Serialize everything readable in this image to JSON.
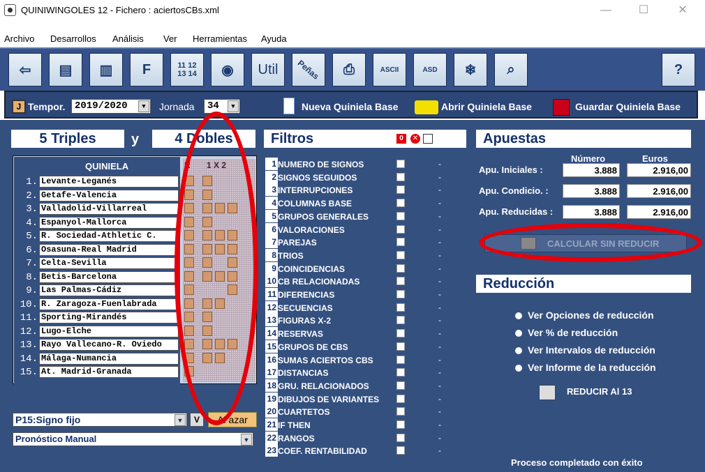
{
  "window": {
    "title": "QUINIWINGOLES 12 - Fichero : aciertosCBs.xml",
    "minimize": "—",
    "maximize": "☐",
    "close": "✕"
  },
  "menu": [
    "Archivo",
    "Desarrollos",
    "Análisis",
    "Ver",
    "Herramientas",
    "Ayuda"
  ],
  "toolbar": {
    "util": "Util",
    "penas": "Peñas",
    "btn_1112": "11 12",
    "btn_1314": "13 14",
    "ascii": "ASCII",
    "asd": "ASD"
  },
  "tbar2": {
    "tempor_label": "Tempor.",
    "tempor_value": "2019/2020",
    "jornada_label": "Jornada",
    "jornada_value": "34",
    "nueva": "Nueva Quiniela Base",
    "abrir": "Abrir Quiniela Base",
    "guardar": "Guardar Quiniela Base"
  },
  "summary": {
    "triples": "5 Triples",
    "y": "y",
    "dobles": "4 Dobles"
  },
  "quiniela": {
    "title": "QUINIELA",
    "col_r": "R",
    "col_1x2": "1 X 2",
    "rows": [
      {
        "n": "1.",
        "match": "Levante-Leganés"
      },
      {
        "n": "2.",
        "match": "Getafe-Valencia"
      },
      {
        "n": "3.",
        "match": "Valladolid-Villarreal"
      },
      {
        "n": "4.",
        "match": "Espanyol-Mallorca"
      },
      {
        "n": "5.",
        "match": "R. Sociedad-Athletic C."
      },
      {
        "n": "6.",
        "match": "Osasuna-Real Madrid"
      },
      {
        "n": "7.",
        "match": "Celta-Sevilla"
      },
      {
        "n": "8.",
        "match": "Betis-Barcelona"
      },
      {
        "n": "9.",
        "match": "Las Palmas-Cádiz"
      },
      {
        "n": "10.",
        "match": "R. Zaragoza-Fuenlabrada"
      },
      {
        "n": "11.",
        "match": "Sporting-Mirandés"
      },
      {
        "n": "12.",
        "match": "Lugo-Elche"
      },
      {
        "n": "13.",
        "match": "Rayo Vallecano-R. Oviedo"
      },
      {
        "n": "14.",
        "match": "Málaga-Numancia"
      },
      {
        "n": "15.",
        "match": "At. Madrid-Granada"
      }
    ],
    "p15_label": "P15:Signo fijo",
    "v": "V",
    "al_azar": "Al azar",
    "pronostico": "Pronóstico Manual"
  },
  "filtros": {
    "title": "Filtros",
    "items": [
      "NUMERO DE SIGNOS",
      "SIGNOS SEGUIDOS",
      "INTERRUPCIONES",
      "COLUMNAS BASE",
      "GRUPOS GENERALES",
      "VALORACIONES",
      "PAREJAS",
      "TRIOS",
      "COINCIDENCIAS",
      "CB RELACIONADAS",
      "DIFERENCIAS",
      "SECUENCIAS",
      "FIGURAS X-2",
      "RESERVAS",
      "GRUPOS DE CBS",
      "SUMAS ACIERTOS CBS",
      "DISTANCIAS",
      "GRU. RELACIONADOS",
      "DIBUJOS DE VARIANTES",
      "CUARTETOS",
      "IF THEN",
      "RANGOS",
      "COEF. RENTABILIDAD"
    ],
    "dash": "-"
  },
  "apuestas": {
    "title": "Apuestas",
    "col_numero": "Número",
    "col_euros": "Euros",
    "rows": [
      {
        "label": "Apu. Iniciales :",
        "numero": "3.888",
        "euros": "2.916,00"
      },
      {
        "label": "Apu. Condicio. :",
        "numero": "3.888",
        "euros": "2.916,00"
      },
      {
        "label": "Apu. Reducidas :",
        "numero": "3.888",
        "euros": "2.916,00"
      }
    ],
    "calcular": "CALCULAR SIN REDUCIR"
  },
  "reduccion": {
    "title": "Reducción",
    "options": [
      "Ver Opciones de reducción",
      "Ver % de reducción",
      "Ver Intervalos de reducción",
      "Ver Informe de la reducción"
    ],
    "reducir": "REDUCIR Al 13"
  },
  "status": "Proceso completado con éxito",
  "colors": {
    "panel_bg": "#34507f",
    "highlight_red": "#e5000a"
  }
}
